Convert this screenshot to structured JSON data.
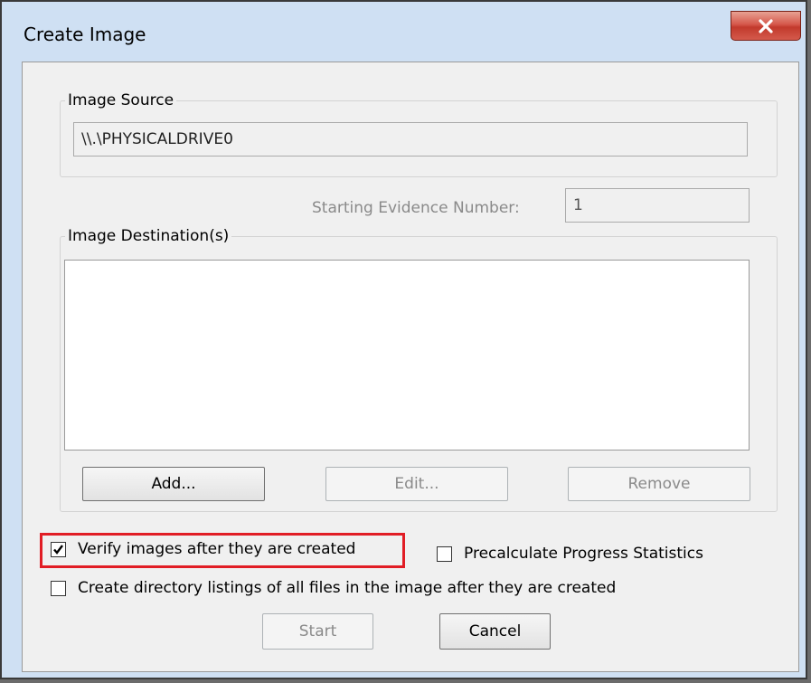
{
  "window": {
    "title": "Create Image",
    "close_icon": "close-x-icon"
  },
  "image_source": {
    "group_label": "Image Source",
    "value": "\\\\.\\PHYSICALDRIVE0"
  },
  "evidence": {
    "label": "Starting Evidence Number:",
    "value": "1"
  },
  "destinations": {
    "group_label": "Image Destination(s)",
    "items": [],
    "add_label": "Add...",
    "edit_label": "Edit...",
    "remove_label": "Remove"
  },
  "options": {
    "verify_label": "Verify images after they are created",
    "verify_checked": true,
    "precalc_label": "Precalculate Progress Statistics",
    "precalc_checked": false,
    "dirlist_label": "Create directory listings of all files in the image after they are created",
    "dirlist_checked": false
  },
  "footer": {
    "start_label": "Start",
    "cancel_label": "Cancel"
  },
  "colors": {
    "highlight": "#e11d25",
    "close_button": "#c9483a"
  }
}
